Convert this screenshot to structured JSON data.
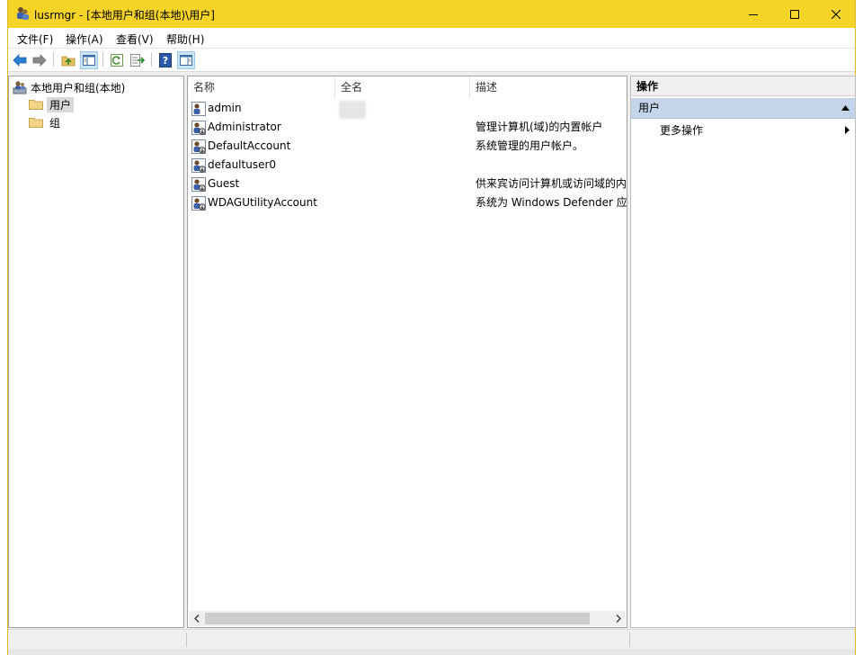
{
  "window": {
    "title": "lusrmgr - [本地用户和组(本地)\\用户]",
    "title_bar_color": "#f5d327",
    "controls": {
      "minimize": "minimize-icon",
      "maximize": "maximize-icon",
      "close": "close-icon"
    }
  },
  "menu": {
    "items": [
      "文件(F)",
      "操作(A)",
      "查看(V)",
      "帮助(H)"
    ]
  },
  "toolbar": {
    "buttons": [
      "back-arrow-icon",
      "forward-arrow-icon",
      "up-folder-icon",
      "show-hide-console-tree-icon",
      "refresh-icon",
      "export-list-icon",
      "help-icon",
      "show-hide-action-pane-icon"
    ]
  },
  "tree": {
    "root": "本地用户和组(本地)",
    "children": [
      {
        "label": "用户",
        "selected": true
      },
      {
        "label": "组",
        "selected": false
      }
    ]
  },
  "list": {
    "columns": [
      "名称",
      "全名",
      "描述"
    ],
    "rows": [
      {
        "name": "admin",
        "fullname": "",
        "description": ""
      },
      {
        "name": "Administrator",
        "fullname": "",
        "description": "管理计算机(域)的内置帐户"
      },
      {
        "name": "DefaultAccount",
        "fullname": "",
        "description": "系统管理的用户帐户。"
      },
      {
        "name": "defaultuser0",
        "fullname": "",
        "description": ""
      },
      {
        "name": "Guest",
        "fullname": "",
        "description": "供来宾访问计算机或访问域的内"
      },
      {
        "name": "WDAGUtilityAccount",
        "fullname": "",
        "description": "系统为 Windows Defender 应"
      }
    ]
  },
  "actions": {
    "header": "操作",
    "section": "用户",
    "items": [
      "更多操作"
    ],
    "section_color": "#c4d4e9"
  }
}
